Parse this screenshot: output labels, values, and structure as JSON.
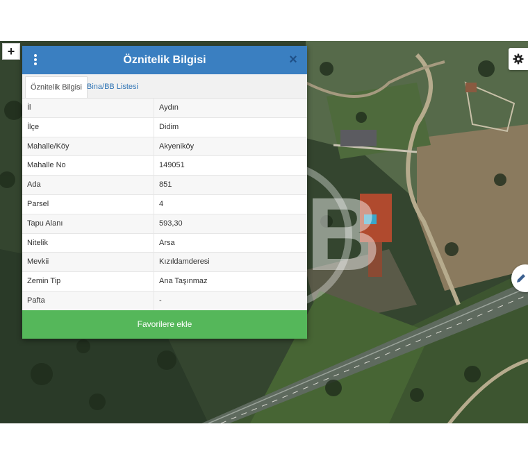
{
  "map": {
    "zoom_in_label": "+",
    "settings_icon": "gear-icon",
    "edit_icon": "pencil-icon",
    "watermark": "B"
  },
  "panel": {
    "title": "Öznitelik Bilgisi",
    "menu_icon": "vertical-dots-icon",
    "close_label": "×",
    "tabs": [
      {
        "label": "Öznitelik Bilgisi",
        "active": true
      },
      {
        "label": "Bina/BB Listesi",
        "active": false
      }
    ],
    "rows": [
      {
        "key": "İl",
        "value": "Aydın"
      },
      {
        "key": "İlçe",
        "value": "Didim"
      },
      {
        "key": "Mahalle/Köy",
        "value": "Akyeniköy"
      },
      {
        "key": "Mahalle No",
        "value": "149051"
      },
      {
        "key": "Ada",
        "value": "851"
      },
      {
        "key": "Parsel",
        "value": "4"
      },
      {
        "key": "Tapu Alanı",
        "value": "593,30"
      },
      {
        "key": "Nitelik",
        "value": "Arsa"
      },
      {
        "key": "Mevkii",
        "value": "Kızıldamderesi"
      },
      {
        "key": "Zemin Tip",
        "value": "Ana Taşınmaz"
      },
      {
        "key": "Pafta",
        "value": "-"
      }
    ],
    "favorite_button": "Favorilere ekle"
  },
  "colors": {
    "header_blue": "#3a7fc1",
    "button_green": "#55b75a",
    "link_blue": "#2f74b5"
  }
}
